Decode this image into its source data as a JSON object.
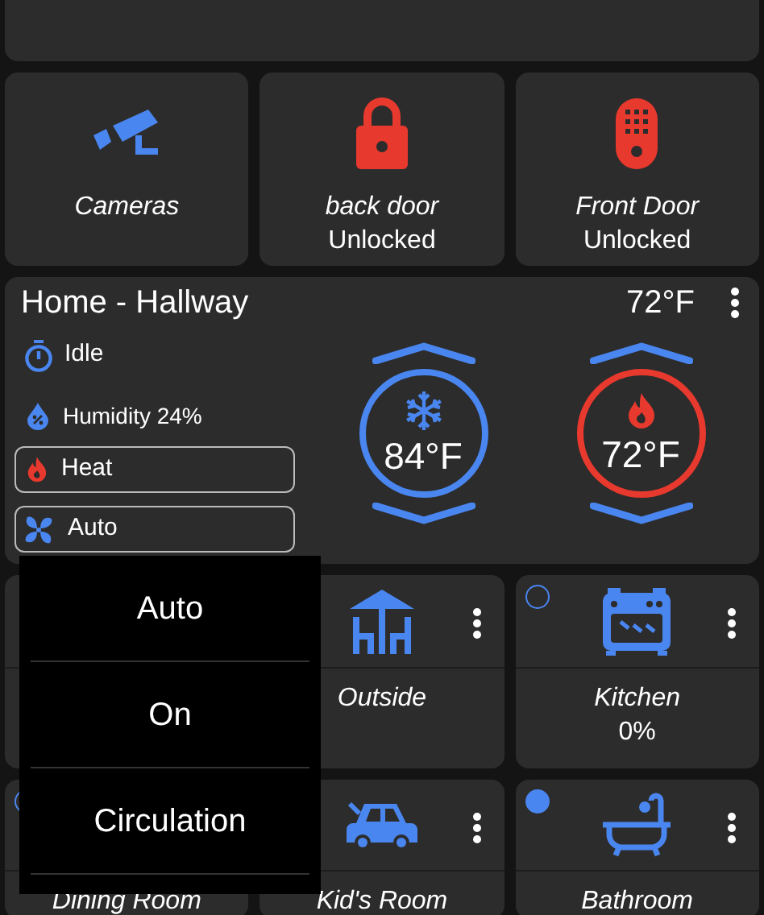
{
  "action_tiles": [
    {
      "kind": "camera",
      "color": "#4a86f0",
      "name": "Cameras"
    },
    {
      "kind": "lock",
      "color": "#e8392e",
      "name": "back door",
      "state": "Unlocked"
    },
    {
      "kind": "keypad",
      "color": "#e8392e",
      "name": "Front Door",
      "state": "Unlocked"
    }
  ],
  "thermostat": {
    "title": "Home - Hallway",
    "current_temp": "72°F",
    "operating_state": "Idle",
    "humidity": "Humidity 24%",
    "mode_button": "Heat",
    "fan_button": "Auto",
    "setpoints": [
      {
        "kind": "cool",
        "value": "84°F"
      },
      {
        "kind": "heat",
        "value": "72°F"
      }
    ]
  },
  "device_tiles": [
    {
      "kind": "covered"
    },
    {
      "kind": "table",
      "name": "Outside"
    },
    {
      "kind": "oven",
      "name": "Kitchen",
      "value": "0%",
      "on": false
    },
    {
      "kind": "covered",
      "name": "Dining Room",
      "on": false
    },
    {
      "kind": "car",
      "name": "Kid's Room"
    },
    {
      "kind": "bath",
      "name": "Bathroom",
      "on": true
    }
  ],
  "fan_menu": {
    "items": [
      {
        "label": "Auto"
      },
      {
        "label": "On"
      },
      {
        "label": "Circulation"
      }
    ]
  }
}
